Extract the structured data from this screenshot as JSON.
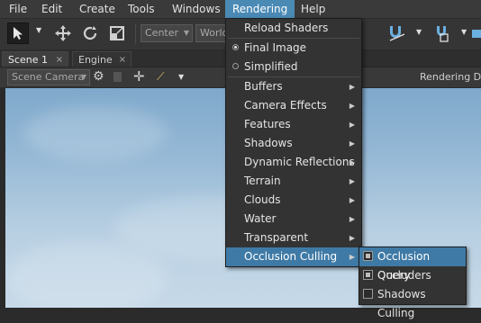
{
  "menubar": {
    "items": [
      "File",
      "Edit",
      "Create",
      "Tools",
      "Windows",
      "Rendering",
      "Help"
    ],
    "active": "Rendering"
  },
  "toolbar": {
    "pivot_combo": "Center",
    "space_combo": "World"
  },
  "tabs": [
    {
      "label": "Scene 1",
      "close": "×"
    },
    {
      "label": "Engine",
      "close": "×"
    }
  ],
  "scene": {
    "camera_combo": "Scene Camera",
    "right_label": "Rendering Deb"
  },
  "rendering_menu": {
    "reload": "Reload Shaders",
    "final_image": "Final Image",
    "simplified": "Simplified",
    "buffers": "Buffers",
    "camera_effects": "Camera Effects",
    "features": "Features",
    "shadows": "Shadows",
    "dynamic_reflections": "Dynamic Reflections",
    "terrain": "Terrain",
    "clouds": "Clouds",
    "water": "Water",
    "transparent": "Transparent",
    "occlusion_culling": "Occlusion Culling"
  },
  "occlusion_submenu": {
    "query": "Occlusion Query",
    "query_checked": true,
    "occluders": "Occluders",
    "occluders_checked": true,
    "shadows_culling": "Shadows Culling",
    "shadows_culling_checked": false
  },
  "colors": {
    "accent": "#4a8ab5",
    "highlight": "#3f7aa6",
    "icon_blue": "#6ab0e0"
  }
}
